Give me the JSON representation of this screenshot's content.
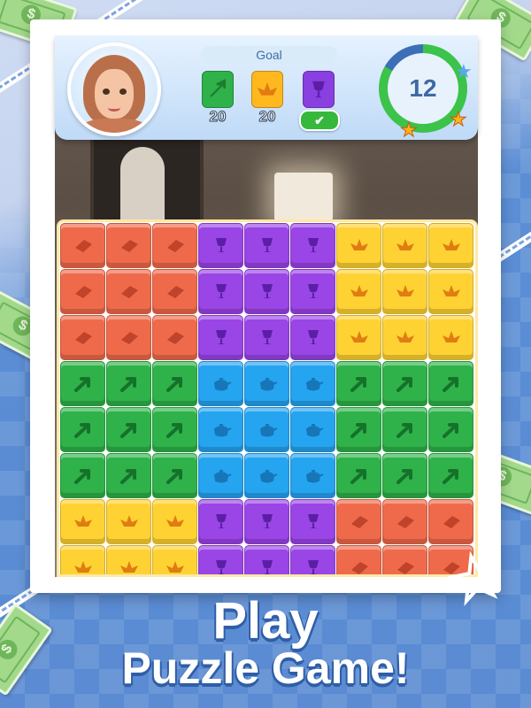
{
  "header": {
    "goal_label": "Goal",
    "moves_left": "12",
    "goals": [
      {
        "type": "green",
        "count": "20",
        "done": false
      },
      {
        "type": "yellow",
        "count": "20",
        "done": false
      },
      {
        "type": "purple",
        "count": "",
        "done": true
      }
    ]
  },
  "colors": {
    "red": "#ef6a4b",
    "purple": "#9a45e6",
    "yellow": "#ffd233",
    "green": "#2fb24a",
    "blue": "#25a4f0"
  },
  "icons": {
    "red": "diamond-icon",
    "purple": "goblet-icon",
    "yellow": "lotus-icon",
    "green": "arrow-icon",
    "blue": "teapot-icon"
  },
  "board": {
    "columns": 9,
    "rows": [
      [
        "R",
        "R",
        "R",
        "P",
        "P",
        "P",
        "Y",
        "Y",
        "Y"
      ],
      [
        "R",
        "R",
        "R",
        "P",
        "P",
        "P",
        "Y",
        "Y",
        "Y"
      ],
      [
        "R",
        "R",
        "R",
        "P",
        "P",
        "P",
        "Y",
        "Y",
        "Y"
      ],
      [
        "G",
        "G",
        "G",
        "B",
        "B",
        "B",
        "G",
        "G",
        "G"
      ],
      [
        "G",
        "G",
        "G",
        "B",
        "B",
        "B",
        "G",
        "G",
        "G"
      ],
      [
        "G",
        "G",
        "G",
        "B",
        "B",
        "B",
        "G",
        "G",
        "G"
      ],
      [
        "Y",
        "Y",
        "Y",
        "P",
        "P",
        "P",
        "R",
        "R",
        "R"
      ],
      [
        "Y",
        "Y",
        "Y",
        "P",
        "P",
        "P",
        "R",
        "R",
        "R"
      ]
    ]
  },
  "promo": {
    "line1": "Play",
    "line2": "Puzzle Game!"
  },
  "decor": {
    "bill_symbol": "$"
  }
}
